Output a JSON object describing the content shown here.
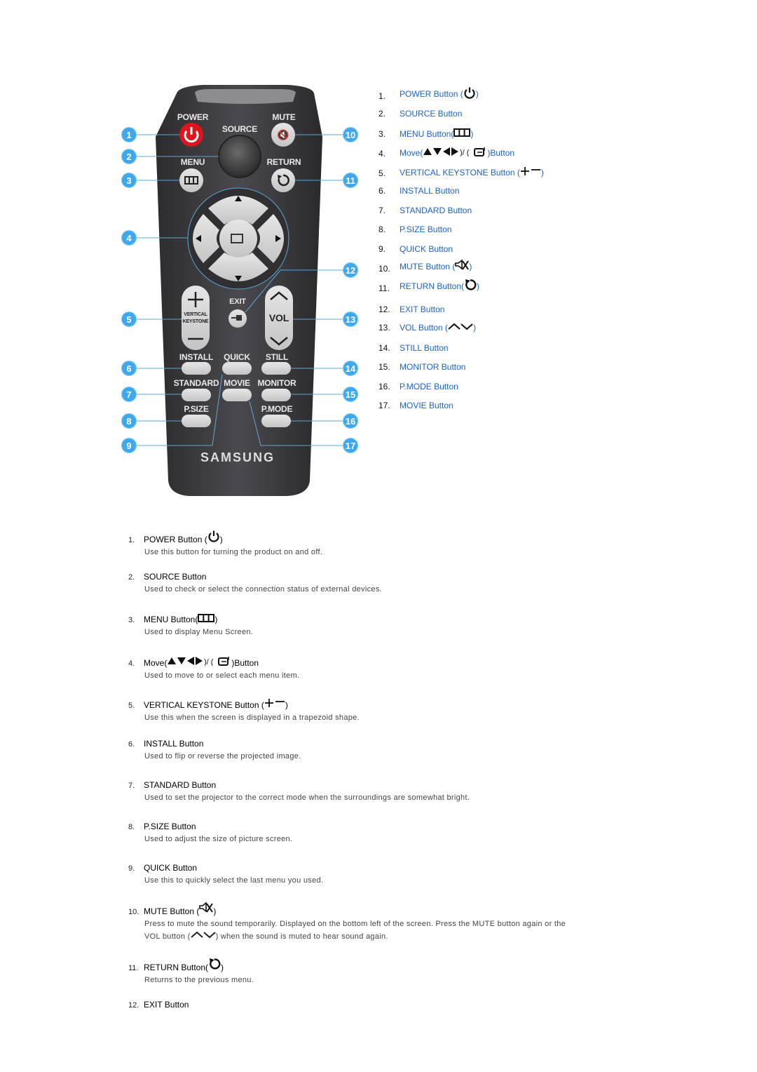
{
  "remote": {
    "brand": "SAMSUNG",
    "labels": {
      "power": "POWER",
      "mute": "MUTE",
      "source": "SOURCE",
      "menu": "MENU",
      "return": "RETURN",
      "exit": "EXIT",
      "vol": "VOL",
      "keystone_line1": "VERTICAL",
      "keystone_line2": "KEYSTONE",
      "install": "INSTALL",
      "quick": "QUICK",
      "still": "STILL",
      "standard": "STANDARD",
      "movie": "MOVIE",
      "monitor": "MONITOR",
      "psize": "P.SIZE",
      "pmode": "P.MODE"
    },
    "callouts": [
      "1",
      "2",
      "3",
      "4",
      "5",
      "6",
      "7",
      "8",
      "9",
      "10",
      "11",
      "12",
      "13",
      "14",
      "15",
      "16",
      "17"
    ],
    "colors": {
      "body": "#3a3a3d",
      "power": "#e0141c",
      "key": "#d4d4d4",
      "callout": "#3fa8ec"
    }
  },
  "index": {
    "link_color": "#1a63c9",
    "items": [
      {
        "num": "1.",
        "label": "POWER Button (",
        "suffix": ")",
        "icon": "power-icon"
      },
      {
        "num": "2.",
        "label": "SOURCE Button",
        "suffix": "",
        "icon": ""
      },
      {
        "num": "3.",
        "label": "MENU Button(",
        "suffix": ")",
        "icon": "menu-icon"
      },
      {
        "num": "4.",
        "label": "Move(",
        "suffix": ")Button",
        "icon": "arrows-enter-icon"
      },
      {
        "num": "5.",
        "label": "VERTICAL KEYSTONE Button (",
        "suffix": ")",
        "icon": "plus-minus-icon"
      },
      {
        "num": "6.",
        "label": "INSTALL Button",
        "suffix": "",
        "icon": ""
      },
      {
        "num": "7.",
        "label": "STANDARD Button",
        "suffix": "",
        "icon": ""
      },
      {
        "num": "8.",
        "label": "P.SIZE Button",
        "suffix": "",
        "icon": ""
      },
      {
        "num": "9.",
        "label": "QUICK Button",
        "suffix": "",
        "icon": ""
      },
      {
        "num": "10.",
        "label": "MUTE Button (",
        "suffix": ")",
        "icon": "mute-icon"
      },
      {
        "num": "11.",
        "label": "RETURN Button(",
        "suffix": ")",
        "icon": "return-icon"
      },
      {
        "num": "12.",
        "label": "EXIT Button",
        "suffix": "",
        "icon": ""
      },
      {
        "num": "13.",
        "label": "VOL Button (",
        "suffix": ")",
        "icon": "vol-icon"
      },
      {
        "num": "14.",
        "label": "STILL Button",
        "suffix": "",
        "icon": ""
      },
      {
        "num": "15.",
        "label": "MONITOR Button",
        "suffix": "",
        "icon": ""
      },
      {
        "num": "16.",
        "label": "P.MODE Button",
        "suffix": "",
        "icon": ""
      },
      {
        "num": "17.",
        "label": "MOVIE Button",
        "suffix": "",
        "icon": ""
      }
    ]
  },
  "descriptions": [
    {
      "num": "1.",
      "title": "POWER Button (",
      "suffix": ")",
      "icon": "power-icon",
      "body": "Use this button for turning the product on and off."
    },
    {
      "num": "2.",
      "title": "SOURCE Button",
      "suffix": "",
      "icon": "",
      "body": "Used to check or select the connection status of external devices."
    },
    {
      "num": "3.",
      "title": "MENU Button(",
      "suffix": ")",
      "icon": "menu-icon",
      "body": "Used to display Menu Screen."
    },
    {
      "num": "4.",
      "title": "Move(",
      "suffix": ")Button",
      "icon": "arrows-enter-icon",
      "body": "Used to move to or select each menu item."
    },
    {
      "num": "5.",
      "title": "VERTICAL KEYSTONE Button (",
      "suffix": ")",
      "icon": "plus-minus-icon",
      "body": "Use this when the screen is displayed in a trapezoid shape."
    },
    {
      "num": "6.",
      "title": "INSTALL Button",
      "suffix": "",
      "icon": "",
      "body": "Used to flip or reverse the projected image."
    },
    {
      "num": "7.",
      "title": "STANDARD Button",
      "suffix": "",
      "icon": "",
      "body": "Used to set the projector to the correct mode when the surroundings are somewhat bright."
    },
    {
      "num": "8.",
      "title": "P.SIZE Button",
      "suffix": "",
      "icon": "",
      "body": "Used to adjust the size of picture screen."
    },
    {
      "num": "9.",
      "title": "QUICK Button",
      "suffix": "",
      "icon": "",
      "body": "Use this to quickly select the last menu you used."
    },
    {
      "num": "10.",
      "title": "MUTE Button (",
      "suffix": ")",
      "icon": "mute-icon",
      "body": "Press to mute the sound temporarily. Displayed on the bottom left of the screen. Press the MUTE button again or the VOL button (∧∨) when the sound is muted to hear sound again.",
      "body_part1": "Press to mute the sound temporarily. Displayed on the bottom left of the screen. Press the MUTE button again or the VOL button (",
      "body_part2": ") when the sound is muted to hear sound again."
    },
    {
      "num": "11.",
      "title": "RETURN Button(",
      "suffix": ")",
      "icon": "return-icon",
      "body": "Returns to the previous menu."
    },
    {
      "num": "12.",
      "title": "EXIT Button",
      "suffix": "",
      "icon": "",
      "body": ""
    }
  ]
}
